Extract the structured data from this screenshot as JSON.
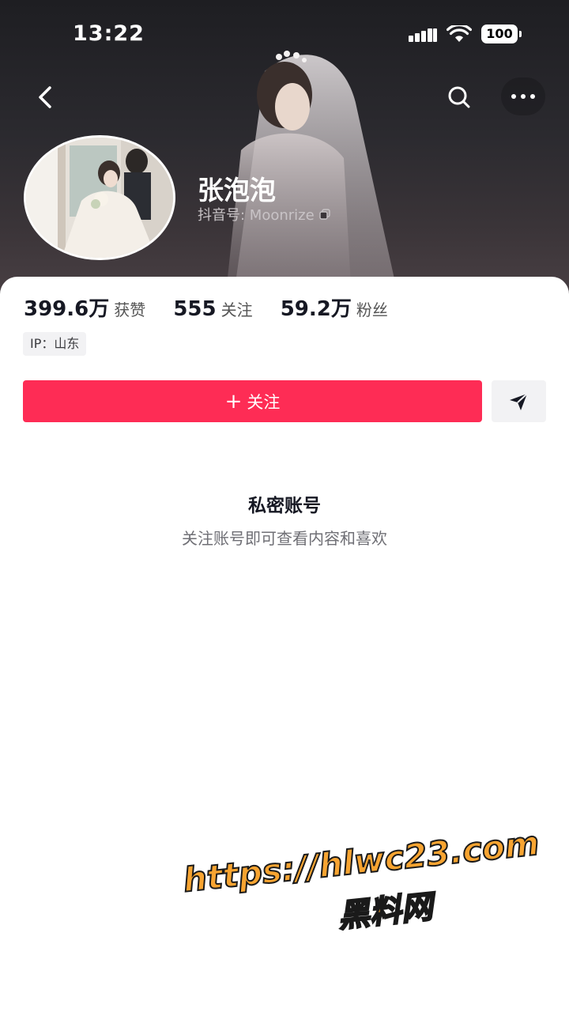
{
  "status_bar": {
    "time": "13:22",
    "battery": "100"
  },
  "nav": {
    "back_icon": "chevron-left-icon",
    "search_icon": "search-icon",
    "more_icon": "more-horizontal-icon"
  },
  "profile": {
    "nickname": "张泡泡",
    "douyin_id_label": "抖音号: ",
    "douyin_id": "Moonrize",
    "copy_icon": "copy-icon"
  },
  "stats": [
    {
      "value": "399.6万",
      "label": "获赞"
    },
    {
      "value": "555",
      "label": "关注"
    },
    {
      "value": "59.2万",
      "label": "粉丝"
    }
  ],
  "ip_location": "IP：山东",
  "actions": {
    "follow_plus": "+",
    "follow_label": "关注",
    "share_icon": "send-icon"
  },
  "private_notice": {
    "title": "私密账号",
    "subtitle": "关注账号即可查看内容和喜欢"
  },
  "watermark": {
    "url": "https://hlwc23.com",
    "text": "黑料网"
  },
  "colors": {
    "accent": "#fe2c55",
    "watermark": "#f7a431"
  }
}
